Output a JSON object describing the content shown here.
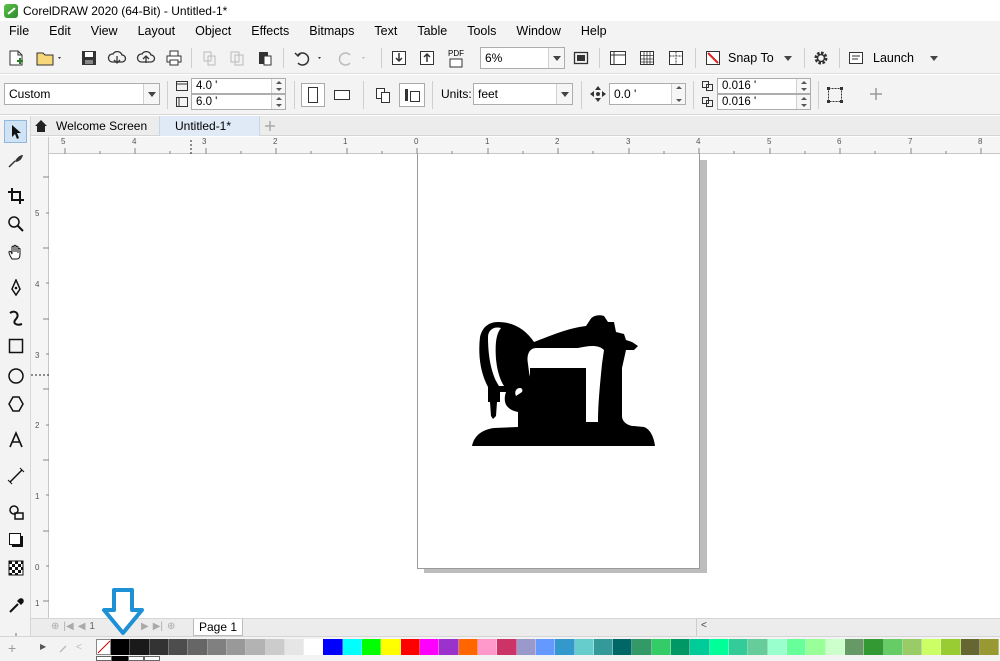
{
  "window": {
    "title": "CorelDRAW 2020 (64-Bit) - Untitled-1*"
  },
  "menu": [
    "File",
    "Edit",
    "View",
    "Layout",
    "Object",
    "Effects",
    "Bitmaps",
    "Text",
    "Table",
    "Tools",
    "Window",
    "Help"
  ],
  "toolbar": {
    "zoom_value": "6%",
    "snap_label": "Snap To",
    "launch_label": "Launch",
    "pdf_label": "PDF"
  },
  "property_bar": {
    "page_preset": "Custom",
    "width": "4.0 '",
    "height": "6.0 '",
    "units_label": "Units:",
    "units_value": "feet",
    "nudge": "0.0 '",
    "dup_x": "0.016 '",
    "dup_y": "0.016 '"
  },
  "tabs": [
    "Welcome Screen",
    "Untitled-1*"
  ],
  "ruler": {
    "h_labels": [
      "5",
      "4",
      "3",
      "2",
      "1",
      "0",
      "1",
      "2",
      "3",
      "4",
      "5",
      "6",
      "7",
      "8"
    ],
    "v_labels": [
      "5",
      "4",
      "3",
      "2",
      "1",
      "0",
      "1"
    ]
  },
  "page_nav": {
    "page_counter": "1",
    "page_tab": "Page 1"
  },
  "palette": {
    "colors": [
      "#000000",
      "#1a1a1a",
      "#333333",
      "#4d4d4d",
      "#666666",
      "#808080",
      "#999999",
      "#b3b3b3",
      "#cccccc",
      "#e6e6e6",
      "#ffffff",
      "#0000ff",
      "#00ffff",
      "#00ff00",
      "#ffff00",
      "#ff0000",
      "#ff00ff",
      "#9933cc",
      "#ff6600",
      "#ff99cc",
      "#cc3366",
      "#9999cc",
      "#6699ff",
      "#3399cc",
      "#66cccc",
      "#339999",
      "#006666",
      "#339966",
      "#33cc66",
      "#009966",
      "#00cc99",
      "#00ff99",
      "#33cc99",
      "#66cc99",
      "#99ffcc",
      "#66ff99",
      "#99ff99",
      "#ccffcc",
      "#669966",
      "#339933",
      "#66cc66",
      "#99cc66",
      "#ccff66",
      "#99cc33",
      "#666633",
      "#999933"
    ]
  },
  "icons": {
    "indicator": "down-arrow-indicator-icon",
    "artwork": "sewing-machine-silhouette"
  },
  "colors": {
    "indicator": "#1e90d6",
    "active_tab": "#dfeaf6"
  }
}
